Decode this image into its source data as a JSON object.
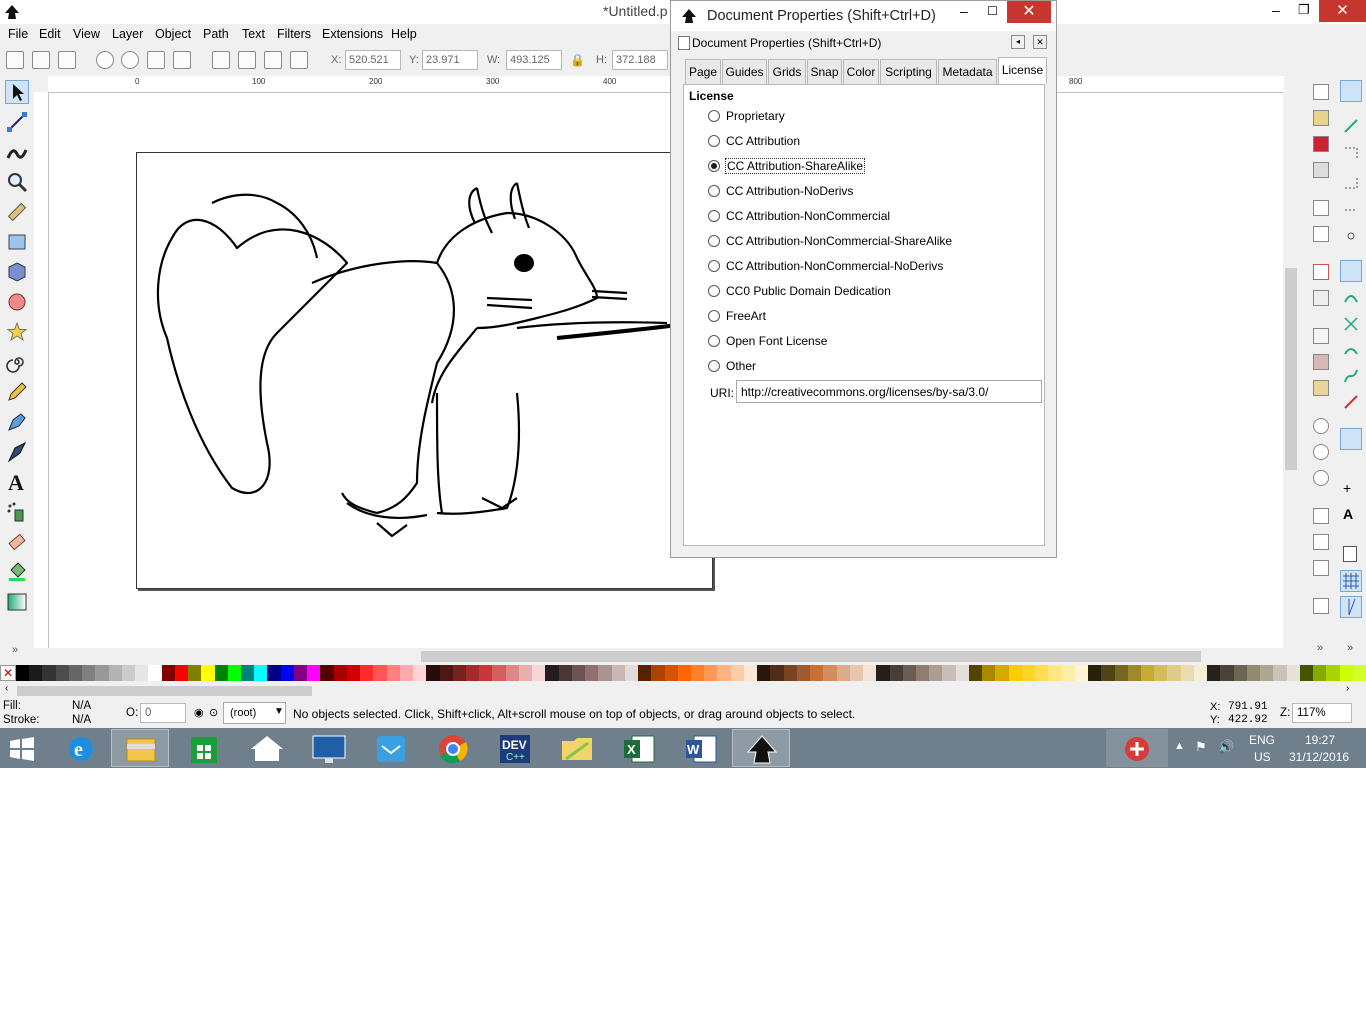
{
  "window": {
    "title": "*Untitled.p"
  },
  "menu": [
    "File",
    "Edit",
    "View",
    "Layer",
    "Object",
    "Path",
    "Text",
    "Filters",
    "Extensions",
    "Help"
  ],
  "toolbar": {
    "x_label": "X:",
    "x_value": "520.521",
    "y_label": "Y:",
    "y_value": "23.971",
    "w_label": "W:",
    "w_value": "493.125",
    "h_label": "H:",
    "h_value": "372.188"
  },
  "ruler": {
    "top_ticks": [
      "0",
      "100",
      "200",
      "300",
      "400",
      "800"
    ]
  },
  "dialog": {
    "title": "Document Properties (Shift+Ctrl+D)",
    "subtitle": "Document Properties (Shift+Ctrl+D)",
    "tabs": [
      "Page",
      "Guides",
      "Grids",
      "Snap",
      "Color",
      "Scripting",
      "Metadata",
      "License"
    ],
    "active_tab": "License",
    "section_label": "License",
    "options": [
      "Proprietary",
      "CC Attribution",
      "CC Attribution-ShareAlike",
      "CC Attribution-NoDerivs",
      "CC Attribution-NonCommercial",
      "CC Attribution-NonCommercial-ShareAlike",
      "CC Attribution-NonCommercial-NoDerivs",
      "CC0 Public Domain Dedication",
      "FreeArt",
      "Open Font License",
      "Other"
    ],
    "selected_option": "CC Attribution-ShareAlike",
    "uri_label": "URI:",
    "uri_value": "http://creativecommons.org/licenses/by-sa/3.0/"
  },
  "status": {
    "fill_label": "Fill:",
    "fill_value": "N/A",
    "stroke_label": "Stroke:",
    "stroke_value": "N/A",
    "opacity_label": "O:",
    "opacity_value": "0",
    "layer_value": "(root)",
    "message": "No objects selected. Click, Shift+click, Alt+scroll mouse on top of objects, or drag around objects to select.",
    "cursor_x_label": "X:",
    "cursor_x": "791.91",
    "cursor_y_label": "Y:",
    "cursor_y": "422.92",
    "zoom_label": "Z:",
    "zoom_value": "117%"
  },
  "taskbar": {
    "lang_top": "ENG",
    "lang_bottom": "US",
    "time": "19:27",
    "date": "31/12/2016",
    "apps": [
      "internet-explorer",
      "file-explorer",
      "store",
      "home",
      "lenovo",
      "mail",
      "chrome",
      "dev-cpp",
      "explorer-folder",
      "excel",
      "word",
      "inkscape"
    ]
  },
  "palette_colors": [
    "#000000",
    "#1a1a1a",
    "#333333",
    "#4d4d4d",
    "#666666",
    "#808080",
    "#999999",
    "#b3b3b3",
    "#cccccc",
    "#e6e6e6",
    "#ffffff",
    "#800000",
    "#ff0000",
    "#808000",
    "#ffff00",
    "#008000",
    "#00ff00",
    "#008080",
    "#00ffff",
    "#000080",
    "#0000ff",
    "#800080",
    "#ff00ff",
    "#550000",
    "#aa0000",
    "#d40000",
    "#ff2a2a",
    "#ff5555",
    "#ff8080",
    "#ffaaaa",
    "#ffd5d5",
    "#280b0b",
    "#501616",
    "#782121",
    "#a02c2c",
    "#c83737",
    "#d35f5f",
    "#de8787",
    "#e9afaf",
    "#f4d7d7",
    "#241c1c",
    "#483737",
    "#6c5353",
    "#916f6f",
    "#ac9393",
    "#c8b7b7",
    "#e3dbdb",
    "#552200",
    "#aa4400",
    "#d45500",
    "#ff6600",
    "#ff7f2a",
    "#ff9955",
    "#ffb380",
    "#ffccaa",
    "#ffe6d5",
    "#28170b",
    "#502d16",
    "#784421",
    "#a05a2c",
    "#c87137",
    "#d38d5f",
    "#deaa87",
    "#e9c6af",
    "#f4e3d7",
    "#241f1c",
    "#483e37",
    "#6c5d53",
    "#917c6f",
    "#ac9d93",
    "#c8beb7",
    "#e3dedb",
    "#554400",
    "#aa8800",
    "#d4aa00",
    "#ffcc00",
    "#ffd42a",
    "#ffdd55",
    "#ffe680",
    "#ffeeaa",
    "#fff6d5",
    "#28220b",
    "#504416",
    "#786721",
    "#a0892c",
    "#c8ab37",
    "#d3bc5f",
    "#decd87",
    "#e9ddaf",
    "#f4eed7",
    "#24221c",
    "#484537",
    "#6c6753",
    "#918a6f",
    "#aca793",
    "#c8c4b7",
    "#e3e2db",
    "#445500",
    "#88aa00",
    "#aad400",
    "#ccff00",
    "#d4ff2a"
  ]
}
